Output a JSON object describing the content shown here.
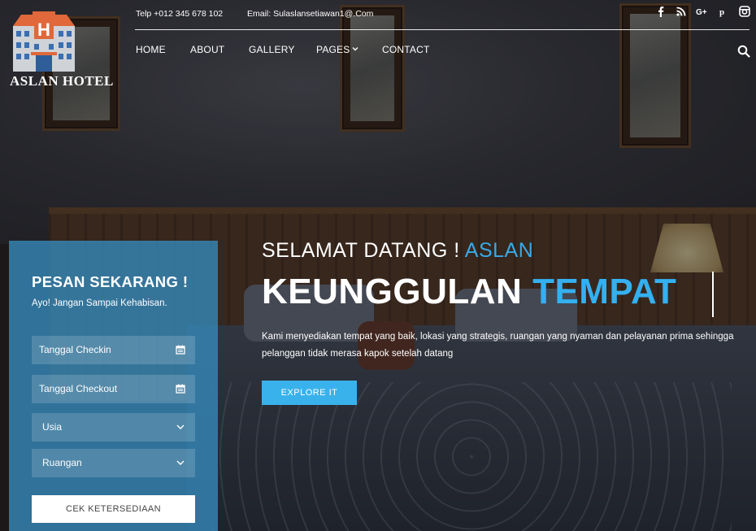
{
  "brand": {
    "logo_text": "ASLAN HOTEL"
  },
  "topbar": {
    "phone": "Telp +012 345 678 102",
    "email": "Email: Sulaslansetiawan1@.Com",
    "social": [
      "facebook-icon",
      "rss-icon",
      "google-plus-icon",
      "pinterest-icon",
      "instagram-icon"
    ]
  },
  "nav": {
    "items": [
      "HOME",
      "ABOUT",
      "GALLERY",
      "PAGES",
      "CONTACT"
    ]
  },
  "hero": {
    "welcome_prefix": "SELAMAT DATANG !",
    "welcome_accent": "ASLAN",
    "headline_prefix": "KEUNGGULAN",
    "headline_accent": "TEMPAT",
    "description": "Kami menyediakan tempat yang baik, lokasi yang strategis, ruangan yang nyaman dan pelayanan prima sehingga pelanggan tidak merasa kapok setelah datang",
    "cta": "EXPLORE IT"
  },
  "booking": {
    "title": "PESAN SEKARANG !",
    "subtitle": "Ayo! Jangan Sampai Kehabisan.",
    "checkin_placeholder": "Tanggal Checkin",
    "checkout_placeholder": "Tanggal Checkout",
    "age_label": "Usia",
    "room_label": "Ruangan",
    "submit": "CEK KETERSEDIAAN"
  },
  "colors": {
    "accent": "#39b2ec",
    "panel": "#368cbe"
  }
}
